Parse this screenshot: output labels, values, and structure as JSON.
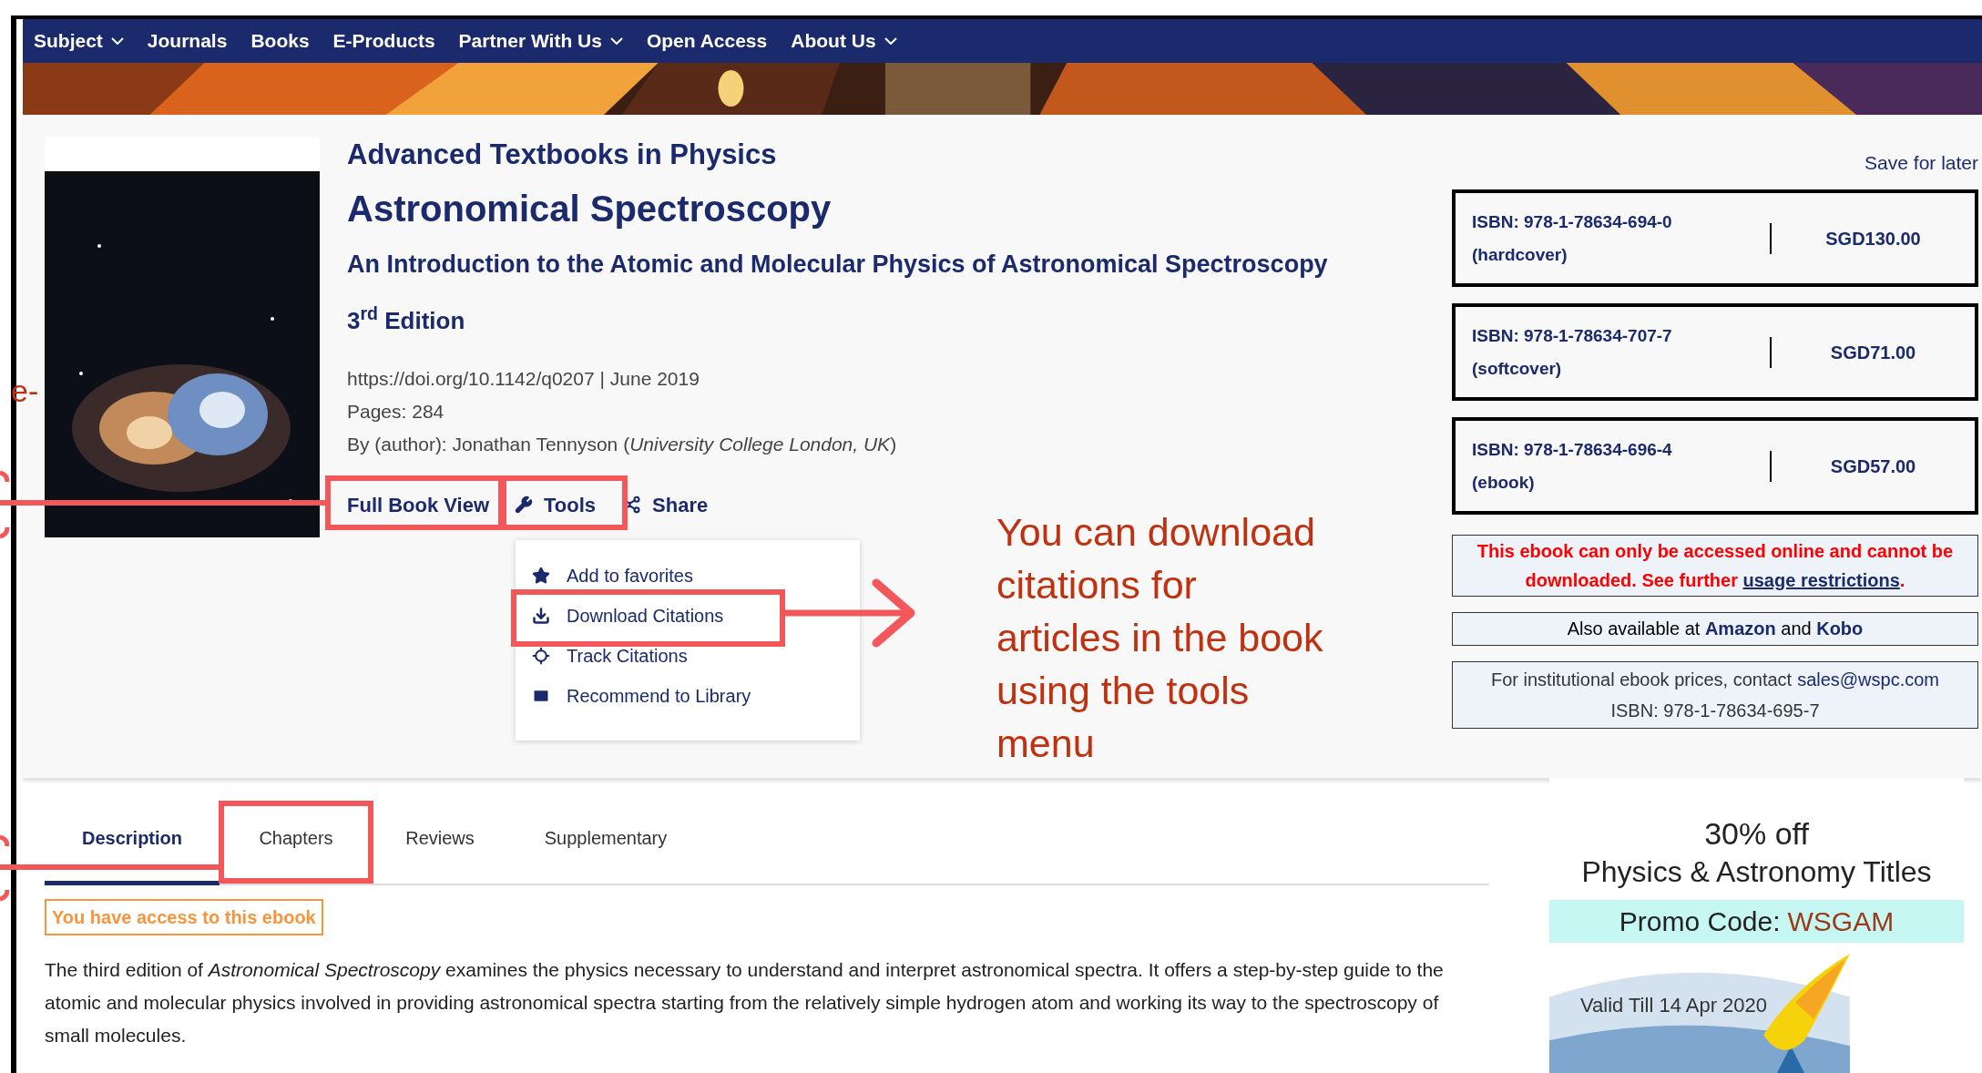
{
  "nav": {
    "items": [
      {
        "label": "Subject",
        "dropdown": true
      },
      {
        "label": "Journals",
        "dropdown": false
      },
      {
        "label": "Books",
        "dropdown": false
      },
      {
        "label": "E-Products",
        "dropdown": false
      },
      {
        "label": "Partner With Us",
        "dropdown": true
      },
      {
        "label": "Open Access",
        "dropdown": false
      },
      {
        "label": "About Us",
        "dropdown": true
      }
    ]
  },
  "book": {
    "series": "Advanced Textbooks in Physics",
    "title": "Astronomical Spectroscopy",
    "subtitle": "An Introduction to the Atomic and Molecular Physics of Astronomical Spectroscopy",
    "edition": "3$^{rd}$ Edition",
    "doi_line": "https://doi.org/10.1142/q0207 | June 2019",
    "pages": "Pages: 284",
    "author": "By (author): Jonathan Tennyson (*University College London, UK*)"
  },
  "actions": [
    {
      "label": "Full Book View",
      "kind": "view"
    },
    {
      "label": "Tools",
      "kind": "tools",
      "expanded": true
    },
    {
      "label": "Share",
      "kind": "share"
    }
  ],
  "tools_menu": [
    {
      "label": "Add to favorites"
    },
    {
      "label": "Download Citations"
    },
    {
      "label": "Track Citations"
    },
    {
      "label": "Recommend to Library"
    }
  ],
  "save_for_later": "Save for later",
  "prices": [
    {
      "isbn": "ISBN: 978-1-78634-694-0",
      "format": "(hardcover)",
      "price": "SGD130.00"
    },
    {
      "isbn": "ISBN: 978-1-78634-707-7",
      "format": "(softcover)",
      "price": "SGD71.00"
    },
    {
      "isbn": "ISBN: 978-1-78634-696-4",
      "format": "(ebook)",
      "price": "SGD57.00"
    }
  ],
  "restriction": {
    "text": "This ebook can only be accessed online and cannot be downloaded. See further",
    "link": "usage restrictions",
    "end": "."
  },
  "availability": "Also available at **Amazon** and **Kobo**",
  "institutional": {
    "text": "For institutional ebook prices, contact",
    "email": "sales@wspc.com",
    "isbn": "ISBN: 978-1-78634-695-7"
  },
  "tabs": [
    {
      "label": "Description",
      "selected": true
    },
    {
      "label": "Chapters",
      "selected": false
    },
    {
      "label": "Reviews",
      "selected": false
    },
    {
      "label": "Supplementary",
      "selected": false
    }
  ],
  "access_badge": "You have access to this ebook",
  "description": "The third edition of *Astronomical Spectroscopy* examines the physics necessary to understand and interpret astronomical spectra. It offers a step-by-step guide to the atomic and molecular physics involved in providing astronomical spectra starting from the relatively simple hydrogen atom and working its way to the spectroscopy of small molecules.",
  "promo": {
    "discount": "30% off",
    "titles": "Physics & Astronomy Titles",
    "code_label": "Promo Code:",
    "code": "WSGAM",
    "validity": "Valid Till 14 Apr 2020"
  },
  "annotations": {
    "callout": "You can download citations for articles in the book using the tools menu",
    "edge_fragment": "e-"
  }
}
